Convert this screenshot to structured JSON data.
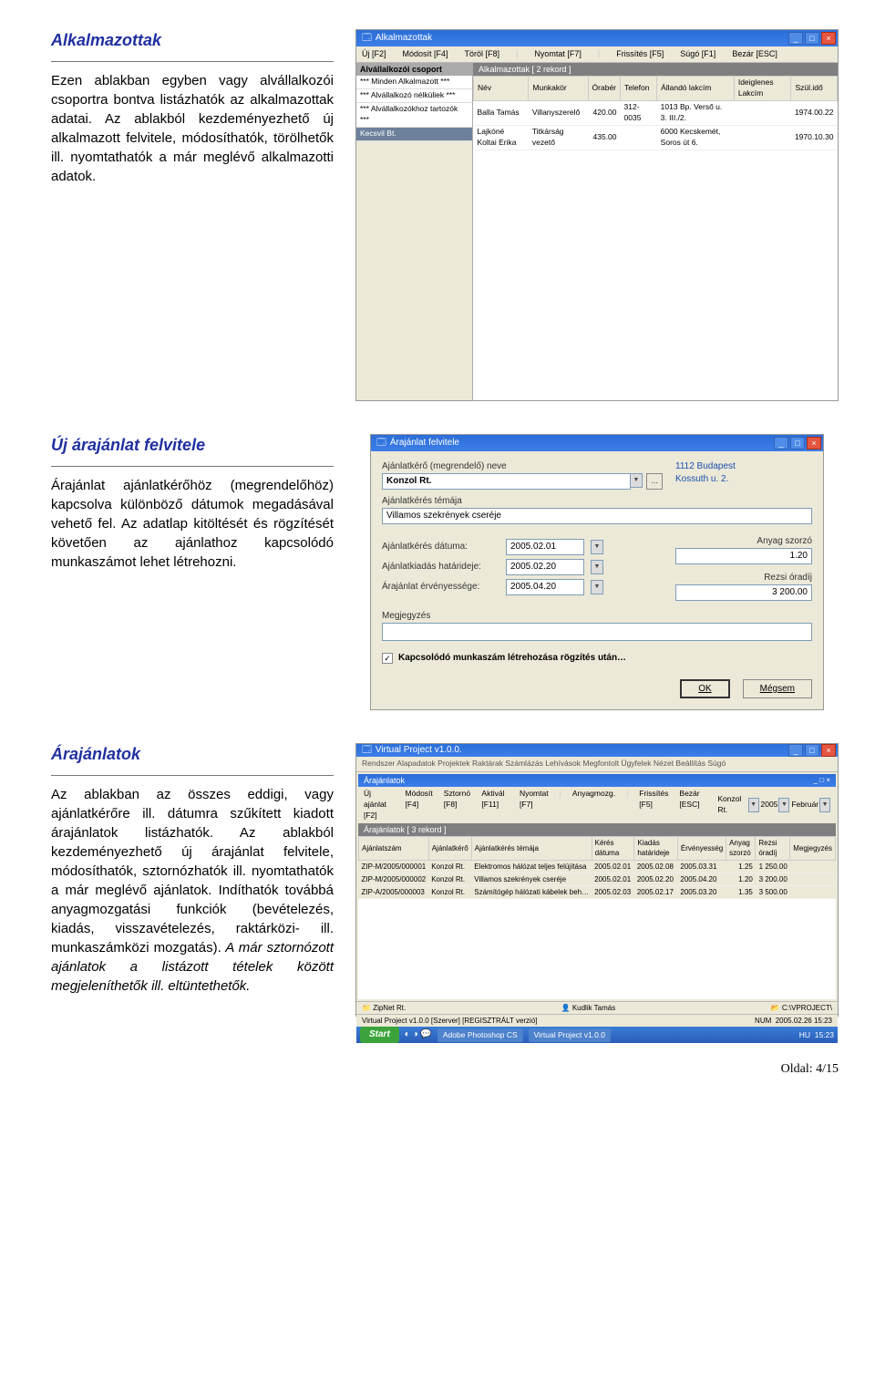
{
  "s1": {
    "heading": "Alkalmazottak",
    "para": "Ezen ablakban egyben vagy alvállalkozói csoportra bontva listázhatók az alkalmazottak adatai. Az ablakból kezdeményezhető új alkalmazott felvitele, módosíthatók, törölhetők ill. nyomtathatók a már meglévő alkalmazotti adatok.",
    "win": {
      "title": "Alkalmazottak",
      "toolbar": [
        "Új [F2]",
        "Módosít [F4]",
        "Töröl [F8]",
        "Nyomtat [F7]",
        "Frissítés [F5]",
        "Súgó [F1]",
        "Bezár [ESC]"
      ],
      "left_header": "Alvállalkozói csoport",
      "left_items": [
        "*** Minden Alkalmazott ***",
        "*** Alvállalkozó nélküliek ***",
        "*** Alvállalkozókhoz tartozók ***",
        "Kecsvil Bt."
      ],
      "list_header": "Alkalmazottak [ 2 rekord ]",
      "cols": [
        "Név",
        "Munkakör",
        "Órabér",
        "Telefon",
        "Állandó lakcím",
        "Ideiglenes Lakcím",
        "Szül.idő"
      ],
      "rows": [
        [
          "Balla Tamás",
          "Villanyszerelő",
          "420.00",
          "312-0035",
          "1013 Bp. Verső u. 3. III./2.",
          "",
          "1974.00.22"
        ],
        [
          "Lajkóné Koltai Erika",
          "Titkárság vezető",
          "435.00",
          "",
          "6000 Kecskemét, Soros út 6.",
          "",
          "1970.10.30"
        ]
      ]
    }
  },
  "s2": {
    "heading": "Új árajánlat felvitele",
    "para": "Árajánlat ajánlatkérőhöz (megrendelőhöz) kapcsolva különböző dátumok megadásával vehető fel. Az adatlap kitöltését és rögzítését követően az ajánlathoz kapcsolódó munkaszámot lehet létrehozni.",
    "dlg": {
      "title": "Árajánlat felvitele",
      "lbl_requester": "Ajánlatkérő (megrendelő) neve",
      "val_requester": "Konzol Rt.",
      "addr_line1": "1112 Budapest",
      "addr_line2": "Kossuth u. 2.",
      "lbl_subject": "Ajánlatkérés témája",
      "val_subject": "Villamos szekrények cseréje",
      "lbl_date1": "Ajánlatkérés dátuma:",
      "val_date1": "2005.02.01",
      "lbl_date2": "Ajánlatkiadás határideje:",
      "val_date2": "2005.02.20",
      "lbl_date3": "Árajánlat érvényessége:",
      "val_date3": "2005.04.20",
      "lbl_mult": "Anyag szorzó",
      "val_mult": "1.20",
      "lbl_rate": "Rezsi óradíj",
      "val_rate": "3 200.00",
      "lbl_note": "Megjegyzés",
      "chk_label": "Kapcsolódó munkaszám létrehozása rögzítés után…",
      "btn_ok": "OK",
      "btn_cancel": "Mégsem"
    }
  },
  "s3": {
    "heading": "Árajánlatok",
    "para": "Az ablakban az összes eddigi, vagy ajánlatkérőre ill. dátumra szűkített kiadott árajánlatok listázhatók. Az ablakból kezdeményezhető új árajánlat felvitele, módosíthatók, sztornózhatók ill. nyomtathatók a már meglévő ajánlatok. Indíthatók továbbá anyagmozgatási funkciók (bevételezés, kiadás, visszavételezés, raktárközi- ill. munkaszámközi mozgatás).",
    "para2": " A már sztornózott ajánlatok a listázott tételek között megjeleníthetők ill. eltüntethetők.",
    "win": {
      "app_title": "Virtual Project v1.0.0.",
      "menus": "Rendszer  Alapadatok  Projektek  Raktárak  Számlázás  Lehívások  Megfontolt  Ügyfelek  Nézet  Beállítás  Súgó",
      "inner_title": "Árajánlatok",
      "filter_client": "Konzol Rt.",
      "filter_year": "2005",
      "filter_month": "Február",
      "toolbar": [
        "Új ajánlat [F2]",
        "Módosít [F4]",
        "Sztornó [F8]",
        "Aktivál [F11]",
        "Nyomtat [F7]",
        "Anyagmozg.",
        "Frissítés [F5]",
        "Bezár [ESC]"
      ],
      "list_header": "Árajánlatok [ 3 rekord ]",
      "cols": [
        "Ajánlatszám",
        "Ajánlatkérő",
        "Ajánlatkérés témája",
        "Kérés dátuma",
        "Kiadás határideje",
        "Érvényesség",
        "Anyag szorzó",
        "Rezsi óradíj",
        "Megjegyzés"
      ],
      "rows": [
        [
          "ZIP-M/2005/000001",
          "Konzol Rt.",
          "Elektromos hálózat teljes felújítása",
          "2005.02.01",
          "2005.02.08",
          "2005.03.31",
          "1.25",
          "1 250.00",
          ""
        ],
        [
          "ZIP-M/2005/000002",
          "Konzol Rt.",
          "Villamos szekrények cseréje",
          "2005.02.01",
          "2005.02.20",
          "2005.04.20",
          "1.20",
          "3 200.00",
          ""
        ],
        [
          "ZIP-A/2005/000003",
          "Konzol Rt.",
          "Számítógép hálózati kábelek beh…",
          "2005.02.03",
          "2005.02.17",
          "2005.03.20",
          "1.35",
          "3 500.00",
          ""
        ]
      ],
      "status_left": "ZipNet Rt.",
      "status_user": "Kudlik Tamás",
      "status_path": "C:\\VPROJECT\\",
      "status_line2": "Virtual Project v1.0.0 [Szerver] [REGISZTRÁLT verzió]",
      "status_caps": "NUM",
      "status_time": "2005.02.26 15:23",
      "taskbar": {
        "start": "Start",
        "tasks": [
          "Adobe Photoshop CS",
          "Virtual Project v1.0.0"
        ],
        "lang": "HU",
        "clock": "15:23"
      }
    }
  },
  "page_num": "Oldal: 4/15"
}
